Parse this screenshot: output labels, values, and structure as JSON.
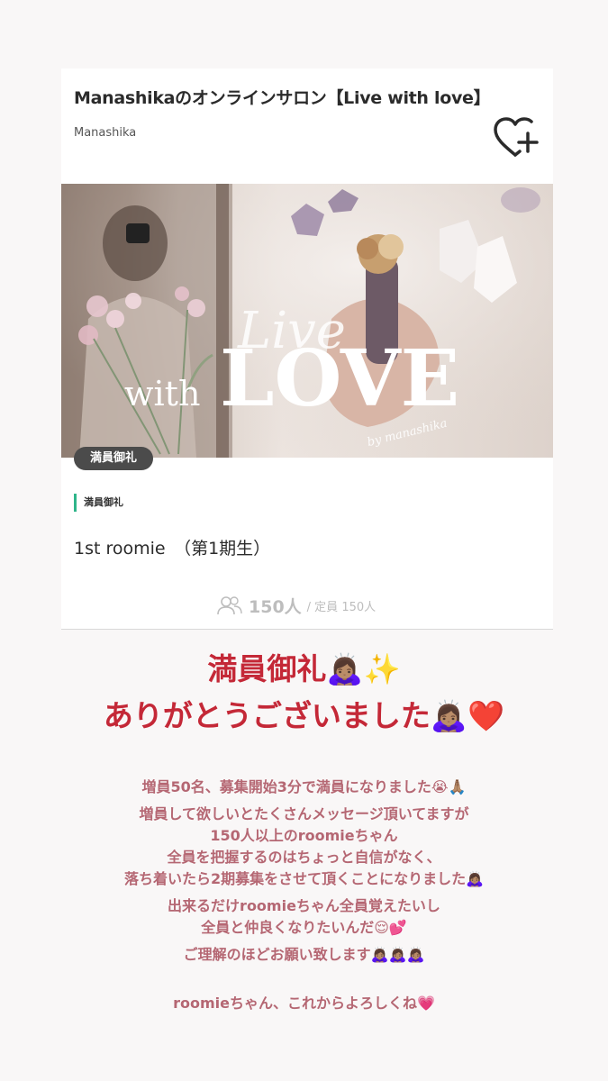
{
  "card": {
    "title": "Manashikaのオンラインサロン【Live with love】",
    "author": "Manashika",
    "favorite_icon": "heart-plus-icon",
    "hero": {
      "script_text": "Live",
      "with_text": "with",
      "love_text": "LOVE",
      "by_text": "by manashika"
    },
    "status_badge": "満員御礼",
    "tag": "満員御礼",
    "plan_name": "1st roomie　（第1期生）",
    "member_icon": "people-icon",
    "member_count": "150人",
    "member_cap": "/ 定員 150人"
  },
  "story": {
    "headline_1": "満員御礼🙇🏽‍♀️✨",
    "headline_2": "ありがとうございました🙇🏽‍♀️❤️",
    "lines": [
      "増員50名、募集開始3分で満員になりました😭🙏🏽",
      "増員して欲しいとたくさんメッセージ頂いてますが",
      "150人以上のroomieちゃん",
      "全員を把握するのはちょっと自信がなく、",
      "落ち着いたら2期募集をさせて頂くことになりました🙇🏽‍♀️",
      "出来るだけroomieちゃん全員覚えたいし",
      "全員と仲良くなりたいんだ😌💕",
      "ご理解のほどお願い致します🙇🏽‍♀️🙇🏽‍♀️🙇🏽‍♀️",
      "roomieちゃん、これからよろしくね💗"
    ]
  },
  "colors": {
    "headline": "#c42837",
    "message": "#b56773",
    "tag_accent": "#2fb58a"
  }
}
